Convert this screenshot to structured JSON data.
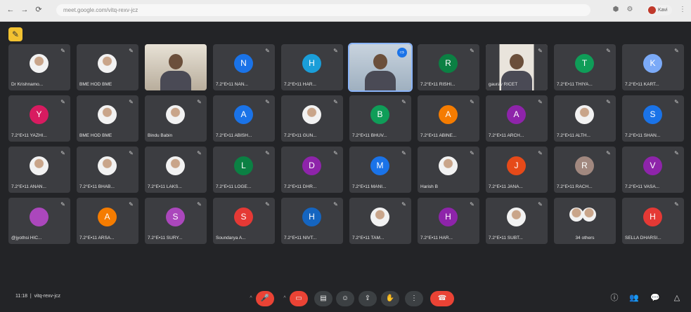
{
  "browser": {
    "url": "meet.google.com/vitq-rexv-jcz",
    "profile": "Kavi"
  },
  "meeting": {
    "time": "11:18",
    "code": "vitq-rexv-jcz"
  },
  "participants": [
    {
      "name": "Dr Krishnamo...",
      "initial": "",
      "color": "",
      "type": "photo"
    },
    {
      "name": "BME HOD BME",
      "initial": "",
      "color": "",
      "type": "photo"
    },
    {
      "name": "",
      "initial": "",
      "color": "",
      "type": "video"
    },
    {
      "name": "7.2°E•11 NAN...",
      "initial": "N",
      "color": "#1a73e8",
      "type": "avatar"
    },
    {
      "name": "7.2°E•11 HAR...",
      "initial": "H",
      "color": "#1a9ed9",
      "type": "avatar"
    },
    {
      "name": "",
      "initial": "",
      "color": "",
      "type": "video-active"
    },
    {
      "name": "7.2°E•11 RISHI...",
      "initial": "R",
      "color": "#0b8043",
      "type": "avatar"
    },
    {
      "name": "gaurav RICET",
      "initial": "",
      "color": "",
      "type": "video-person"
    },
    {
      "name": "7.2°E•11 THIYA...",
      "initial": "T",
      "color": "#0f9d58",
      "type": "avatar"
    },
    {
      "name": "7.2°E•11 KART...",
      "initial": "K",
      "color": "#7baaf7",
      "type": "avatar"
    },
    {
      "name": "7.2°E•11 YAZHI...",
      "initial": "Y",
      "color": "#d81b60",
      "type": "avatar"
    },
    {
      "name": "BME HOD BME",
      "initial": "",
      "color": "",
      "type": "photo"
    },
    {
      "name": "Bindu Babin",
      "initial": "",
      "color": "",
      "type": "photo"
    },
    {
      "name": "7.2°E•11 ABISH...",
      "initial": "A",
      "color": "#1a73e8",
      "type": "avatar"
    },
    {
      "name": "7.2°E•11 GUN...",
      "initial": "",
      "color": "",
      "type": "photo"
    },
    {
      "name": "7.2°E•11 BHUV...",
      "initial": "B",
      "color": "#0f9d58",
      "type": "avatar"
    },
    {
      "name": "7.2°E•11 ABINE...",
      "initial": "A",
      "color": "#f57c00",
      "type": "avatar"
    },
    {
      "name": "7.2°E•11 ARCH...",
      "initial": "A",
      "color": "#8e24aa",
      "type": "avatar"
    },
    {
      "name": "7.2°E•11 ALTH...",
      "initial": "",
      "color": "",
      "type": "photo"
    },
    {
      "name": "7.2°E•11 SHAN...",
      "initial": "S",
      "color": "#1a73e8",
      "type": "avatar"
    },
    {
      "name": "7.2°E•11 ANAN...",
      "initial": "",
      "color": "",
      "type": "photo"
    },
    {
      "name": "7.2°E•11 BHAB...",
      "initial": "",
      "color": "",
      "type": "photo"
    },
    {
      "name": "7.2°E•11 LAKS...",
      "initial": "",
      "color": "",
      "type": "photo"
    },
    {
      "name": "7.2°E•11 LOGE...",
      "initial": "L",
      "color": "#0b8043",
      "type": "avatar"
    },
    {
      "name": "7.2°E•11 DHR...",
      "initial": "D",
      "color": "#8e24aa",
      "type": "avatar"
    },
    {
      "name": "7.2°E•11 MANI...",
      "initial": "M",
      "color": "#1a73e8",
      "type": "avatar"
    },
    {
      "name": "Harish B",
      "initial": "",
      "color": "",
      "type": "photo"
    },
    {
      "name": "7.2°E•11 JANA...",
      "initial": "J",
      "color": "#e64a19",
      "type": "avatar"
    },
    {
      "name": "7.2°E•11 RACH...",
      "initial": "R",
      "color": "#a1887f",
      "type": "avatar"
    },
    {
      "name": "7.2°E•11 VASA...",
      "initial": "V",
      "color": "#8e24aa",
      "type": "avatar"
    },
    {
      "name": "@jyothsi HIC...",
      "initial": "",
      "color": "#ab47bc",
      "type": "avatar"
    },
    {
      "name": "7.2°E•11 ARSA...",
      "initial": "A",
      "color": "#f57c00",
      "type": "avatar"
    },
    {
      "name": "7.2°E•11 SURY...",
      "initial": "S",
      "color": "#ab47bc",
      "type": "avatar"
    },
    {
      "name": "Soundarya A...",
      "initial": "S",
      "color": "#e53935",
      "type": "avatar"
    },
    {
      "name": "7.2°E•11 NIVT...",
      "initial": "H",
      "color": "#1565c0",
      "type": "avatar"
    },
    {
      "name": "7.2°E•11 TAM...",
      "initial": "",
      "color": "",
      "type": "photo"
    },
    {
      "name": "7.2°E•11 HAR...",
      "initial": "H",
      "color": "#8e24aa",
      "type": "avatar"
    },
    {
      "name": "7.2°E•11 SUBT...",
      "initial": "",
      "color": "",
      "type": "photo"
    },
    {
      "name": "34 others",
      "initial": "",
      "color": "",
      "type": "others"
    },
    {
      "name": "SELLA DHARSI...",
      "initial": "H",
      "color": "#e53935",
      "type": "avatar"
    }
  ],
  "controls": {
    "mic_icon": "mic-off-icon",
    "cam_icon": "camera-off-icon",
    "captions_icon": "captions-icon",
    "emoji_icon": "emoji-icon",
    "present_icon": "present-icon",
    "hand_icon": "raise-hand-icon",
    "more_icon": "more-icon",
    "end_icon": "end-call-icon"
  },
  "colors": {
    "accent_red": "#ea4335",
    "meet_bg": "#232427",
    "tile_bg": "#3c3d41"
  }
}
